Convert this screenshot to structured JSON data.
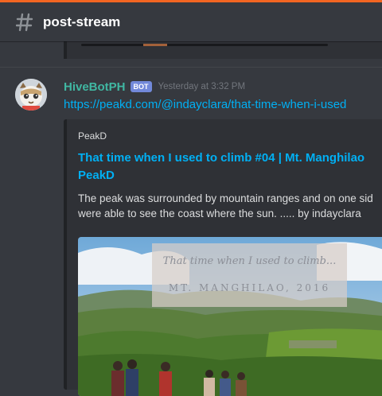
{
  "channel": {
    "name": "post-stream"
  },
  "message": {
    "author": "HiveBotPH",
    "tag": "BOT",
    "timestamp": "Yesterday at 3:32 PM",
    "link": "https://peakd.com/@indayclara/that-time-when-i-used"
  },
  "embed": {
    "provider": "PeakD",
    "title_line1": "That time when I used to climb #04 | Mt. Manghilao",
    "title_line2": "PeakD",
    "desc_line1": "The peak was surrounded by mountain ranges and on one sid",
    "desc_line2": "were able to see the coast where the sun. ..... by indayclara",
    "image_caption_script": "That time when I used to climb...",
    "image_caption_place": "MT. MANGHILAO, 2016"
  },
  "colors": {
    "username": "#40b7a2",
    "link": "#00b0f4",
    "bot_tag": "#7289da",
    "accent_bar": "#f26522"
  },
  "icons": {
    "channel": "hash-icon",
    "avatar": "bot-avatar"
  }
}
